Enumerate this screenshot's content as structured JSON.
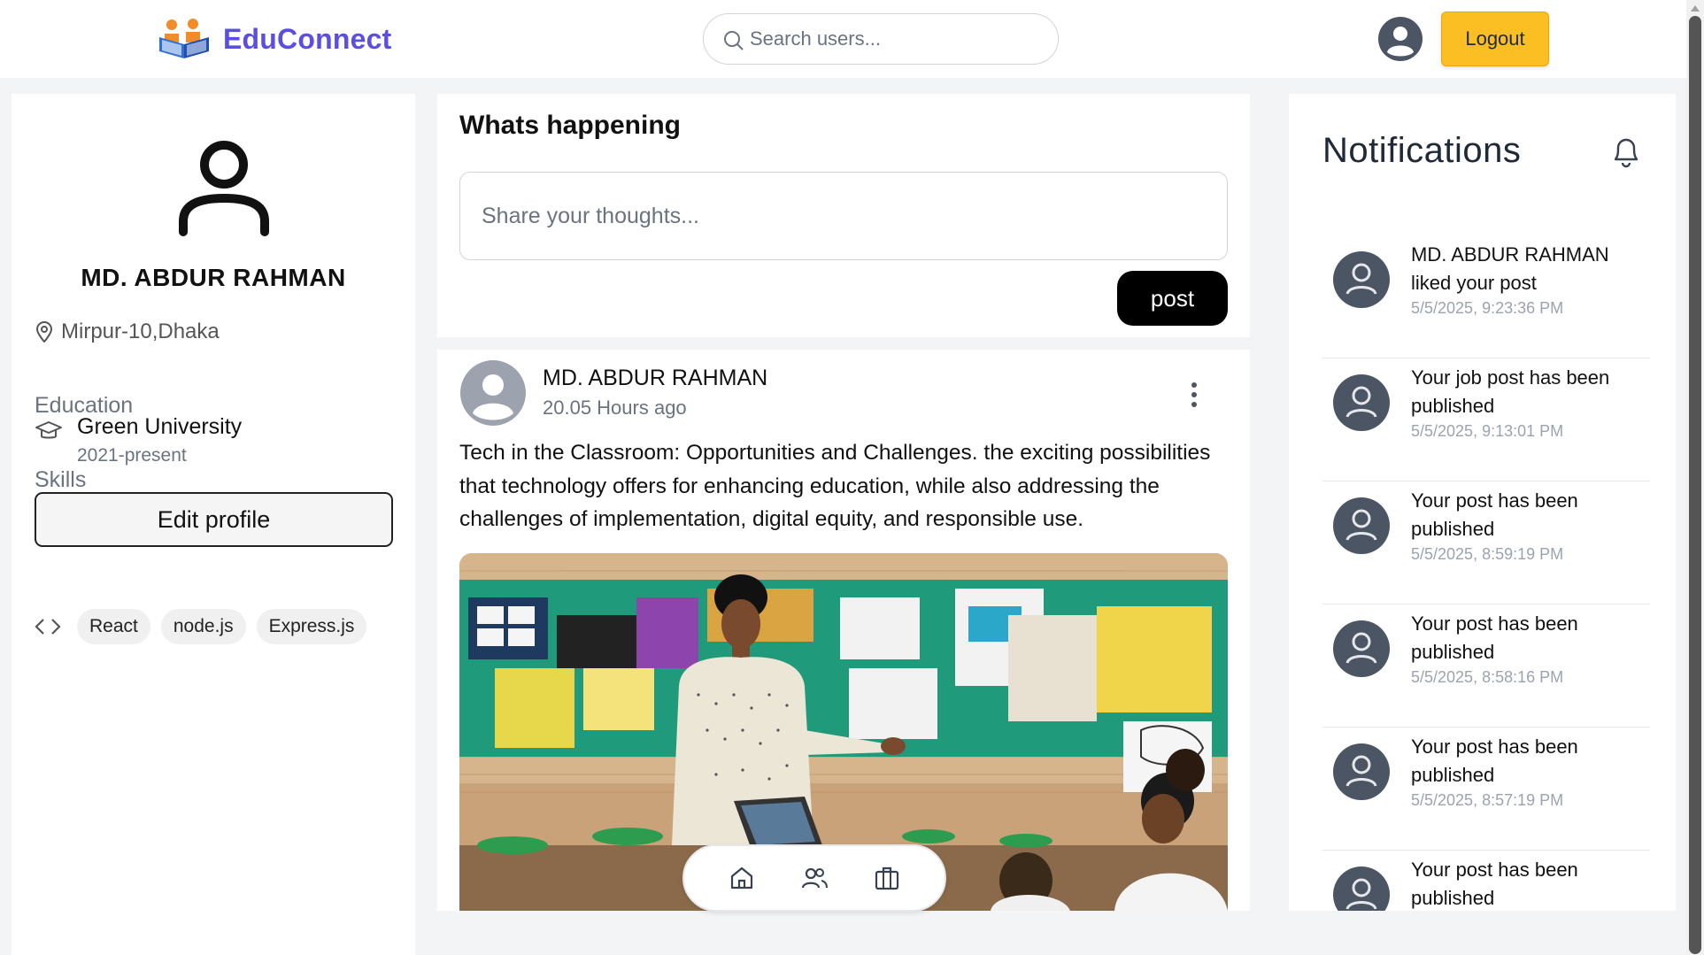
{
  "app": {
    "name": "EduConnect",
    "search_placeholder": "Search users...",
    "logout_label": "Logout"
  },
  "profile": {
    "name": "MD. ABDUR RAHMAN",
    "location": "Mirpur-10,Dhaka",
    "education_title": "Education",
    "education": {
      "school": "Green University",
      "years": "2021-present"
    },
    "edit_label": "Edit profile",
    "skills_title": "Skills",
    "skills": [
      "React",
      "node.js",
      "Express.js"
    ]
  },
  "composer": {
    "title": "Whats happening",
    "placeholder": "Share your thoughts...",
    "post_label": "post"
  },
  "post": {
    "author": "MD. ABDUR RAHMAN",
    "time": "20.05 Hours ago",
    "text": "Tech in the Classroom: Opportunities and Challenges. the exciting possibilities that technology offers for enhancing education, while also addressing the challenges of implementation, digital equity, and responsible use."
  },
  "notifications": {
    "title": "Notifications",
    "items": [
      {
        "message": "MD. ABDUR RAHMAN liked your post",
        "date": "5/5/2025, 9:23:36 PM"
      },
      {
        "message": "Your job post has been published",
        "date": "5/5/2025, 9:13:01 PM"
      },
      {
        "message": "Your post has been published",
        "date": "5/5/2025, 8:59:19 PM"
      },
      {
        "message": "Your post has been published",
        "date": "5/5/2025, 8:58:16 PM"
      },
      {
        "message": "Your post has been published",
        "date": "5/5/2025, 8:57:19 PM"
      },
      {
        "message": "Your post has been published",
        "date": ""
      }
    ]
  },
  "colors": {
    "brand": "#5b4fe0",
    "logout": "#fbbf24",
    "post_button": "#000000"
  },
  "icons": [
    "logo-icon",
    "search-icon",
    "user-avatar-icon",
    "location-pin-icon",
    "graduation-cap-icon",
    "code-icon",
    "more-vertical-icon",
    "bell-icon",
    "home-icon",
    "users-icon",
    "briefcase-icon"
  ]
}
